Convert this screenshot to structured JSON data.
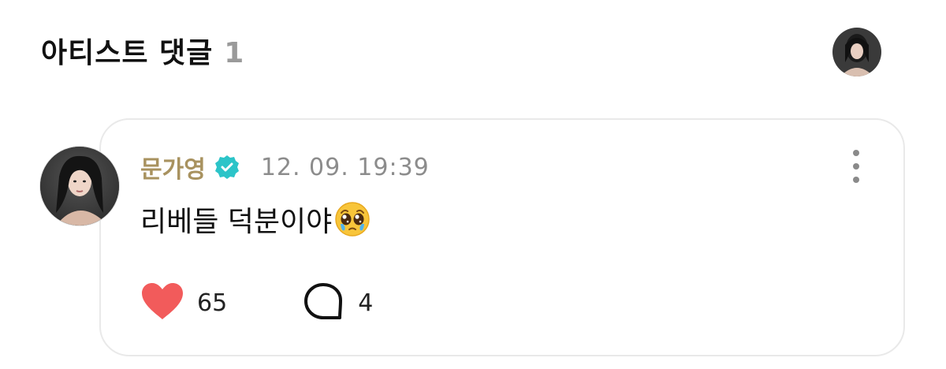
{
  "header": {
    "title": "아티스트 댓글",
    "count": "1"
  },
  "comment": {
    "author": "문가영",
    "verified": true,
    "timestamp": "12. 09. 19:39",
    "text": "리베들 덕분이야",
    "emoji": "pleading-face",
    "likes": "65",
    "replies": "4"
  },
  "colors": {
    "author": "#a8925f",
    "verified_badge": "#2cc4c8",
    "heart": "#f25b5b",
    "timestamp": "#8c8c8c",
    "card_border": "#e9e9e9"
  },
  "icons": {
    "verified": "verified-badge-icon",
    "more": "more-vertical-icon",
    "like": "heart-icon",
    "reply": "comment-bubble-icon"
  }
}
